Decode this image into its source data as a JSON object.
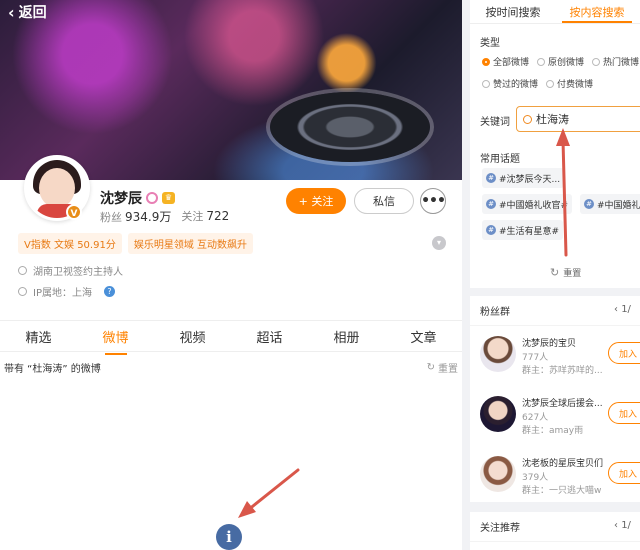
{
  "profile": {
    "back_label": "返回",
    "name": "沈梦辰",
    "verified_mark": "V",
    "fans_label": "粉丝",
    "fans_value": "934.9万",
    "follow_label": "关注",
    "follow_value": "722",
    "follow_button": "+ 关注",
    "message_button": "私信",
    "more_button": "•••",
    "tags": [
      "V指数 文娱 50.91分",
      "娱乐明星领域 互动数飙升"
    ],
    "info_line1": "湖南卫视签约主持人",
    "info_line2": "IP属地：上海"
  },
  "tabs": [
    "精选",
    "微博",
    "视频",
    "超话",
    "相册",
    "文章"
  ],
  "active_tab": "微博",
  "filter": {
    "text": "带有 “杜海涛” 的微博",
    "reset": "重置"
  },
  "search_panel": {
    "tabs": [
      "按时间搜索",
      "按内容搜索"
    ],
    "active_tab": "按内容搜索",
    "type_label": "类型",
    "radio_rows": [
      [
        "全部微博",
        "原创微博",
        "热门微博"
      ],
      [
        "赞过的微博",
        "付费微博"
      ]
    ],
    "selected_type": "全部微博",
    "keyword_label": "关键词",
    "keyword_value": "杜海涛",
    "topics_label": "常用话题",
    "topics": [
      "#沈梦辰今天...",
      "#中國婚礼收官#",
      "#中国婚礼#",
      "#生活有星意#"
    ],
    "reset": "重置"
  },
  "fan_groups": {
    "title": "粉丝群",
    "page": "1/",
    "join_label": "加入",
    "groups": [
      {
        "name": "沈梦辰的宝贝",
        "count": "777人",
        "owner": "群主：苏咩苏咩的..."
      },
      {
        "name": "沈梦辰全球后援会...",
        "count": "627人",
        "owner": "群主：amay雨"
      },
      {
        "name": "沈老板的星辰宝贝们",
        "count": "379人",
        "owner": "群主：一只逃大喵w"
      }
    ]
  },
  "recommend": {
    "title": "关注推荐",
    "page": "1/"
  },
  "colors": {
    "accent": "#ff8200",
    "info_icon": "#476ba3",
    "arrow": "#d9574a"
  }
}
